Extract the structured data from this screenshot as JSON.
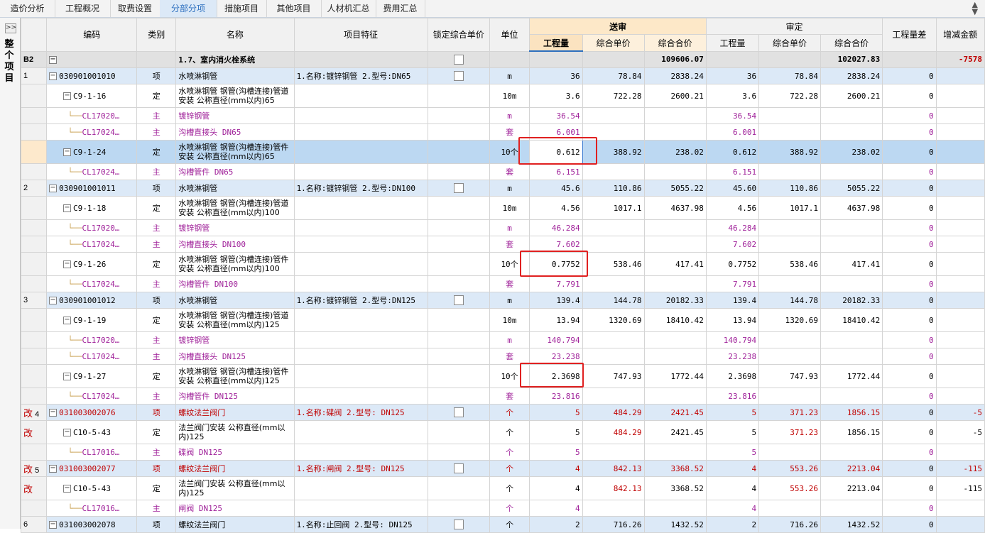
{
  "tabs": [
    "造价分析",
    "工程概况",
    "取费设置",
    "分部分项",
    "措施项目",
    "其他项目",
    "人材机汇总",
    "费用汇总"
  ],
  "active_tab": "分部分项",
  "side_title": "整个项目",
  "header": {
    "code": "编码",
    "type": "类别",
    "name": "名称",
    "feature": "项目特征",
    "lock": "锁定综合单价",
    "unit": "单位",
    "send": "送审",
    "approve": "审定",
    "qty": "工程量",
    "uprice": "综合单价",
    "total": "综合合价",
    "diff": "工程量差",
    "incdec": "增减金额"
  },
  "rows": [
    {
      "style": "sec",
      "no": "B2",
      "code": "",
      "type": "",
      "name": "1.7、室内消火栓系统",
      "feature": "",
      "lock": true,
      "unit": "",
      "sq": "",
      "sp": "",
      "st": "109606.07",
      "aq": "",
      "ap": "",
      "at": "102027.83",
      "diff": "",
      "inc": "-7578"
    },
    {
      "style": "qd",
      "no": "1",
      "code": "030901001010",
      "type": "项",
      "name": "水喷淋钢管",
      "feature": "1.名称:镀锌钢管 2.型号:DN65",
      "lock": true,
      "unit": "m",
      "sq": "36",
      "sp": "78.84",
      "st": "2838.24",
      "aq": "36",
      "ap": "78.84",
      "at": "2838.24",
      "diff": "0",
      "inc": ""
    },
    {
      "style": "de",
      "no": "",
      "code": "C9-1-16",
      "type": "定",
      "name": "水喷淋钢管 钢管(沟槽连接)管道安装 公称直径(mm以内)65",
      "feature": "",
      "lock": false,
      "unit": "10m",
      "sq": "3.6",
      "sp": "722.28",
      "st": "2600.21",
      "aq": "3.6",
      "ap": "722.28",
      "at": "2600.21",
      "diff": "0",
      "inc": ""
    },
    {
      "style": "zc",
      "no": "",
      "code": "CL17020…",
      "type": "主",
      "name": "镀锌钢管",
      "feature": "",
      "lock": false,
      "unit": "m",
      "sq": "36.54",
      "sp": "",
      "st": "",
      "aq": "36.54",
      "ap": "",
      "at": "",
      "diff": "0",
      "inc": ""
    },
    {
      "style": "zc",
      "no": "",
      "code": "CL17024…",
      "type": "主",
      "name": "沟槽直接头 DN65",
      "feature": "",
      "lock": false,
      "unit": "套",
      "sq": "6.001",
      "sp": "",
      "st": "",
      "aq": "6.001",
      "ap": "",
      "at": "",
      "diff": "0",
      "inc": ""
    },
    {
      "style": "sel",
      "no": "",
      "code": "C9-1-24",
      "type": "定",
      "name": "水喷淋钢管 钢管(沟槽连接)管件安装 公称直径(mm以内)65",
      "feature": "",
      "lock": false,
      "unit": "10个",
      "sq": "0.612",
      "sp": "388.92",
      "st": "238.02",
      "aq": "0.612",
      "ap": "388.92",
      "at": "238.02",
      "diff": "0",
      "inc": ""
    },
    {
      "style": "zc",
      "no": "",
      "code": "CL17024…",
      "type": "主",
      "name": "沟槽管件 DN65",
      "feature": "",
      "lock": false,
      "unit": "套",
      "sq": "6.151",
      "sp": "",
      "st": "",
      "aq": "6.151",
      "ap": "",
      "at": "",
      "diff": "0",
      "inc": ""
    },
    {
      "style": "qd",
      "no": "2",
      "code": "030901001011",
      "type": "项",
      "name": "水喷淋钢管",
      "feature": "1.名称:镀锌钢管 2.型号:DN100",
      "lock": true,
      "unit": "m",
      "sq": "45.6",
      "sp": "110.86",
      "st": "5055.22",
      "aq": "45.60",
      "ap": "110.86",
      "at": "5055.22",
      "diff": "0",
      "inc": ""
    },
    {
      "style": "de",
      "no": "",
      "code": "C9-1-18",
      "type": "定",
      "name": "水喷淋钢管 钢管(沟槽连接)管道安装 公称直径(mm以内)100",
      "feature": "",
      "lock": false,
      "unit": "10m",
      "sq": "4.56",
      "sp": "1017.1",
      "st": "4637.98",
      "aq": "4.56",
      "ap": "1017.1",
      "at": "4637.98",
      "diff": "0",
      "inc": ""
    },
    {
      "style": "zc",
      "no": "",
      "code": "CL17020…",
      "type": "主",
      "name": "镀锌钢管",
      "feature": "",
      "lock": false,
      "unit": "m",
      "sq": "46.284",
      "sp": "",
      "st": "",
      "aq": "46.284",
      "ap": "",
      "at": "",
      "diff": "0",
      "inc": ""
    },
    {
      "style": "zc",
      "no": "",
      "code": "CL17024…",
      "type": "主",
      "name": "沟槽直接头 DN100",
      "feature": "",
      "lock": false,
      "unit": "套",
      "sq": "7.602",
      "sp": "",
      "st": "",
      "aq": "7.602",
      "ap": "",
      "at": "",
      "diff": "0",
      "inc": ""
    },
    {
      "style": "de",
      "no": "",
      "code": "C9-1-26",
      "type": "定",
      "name": "水喷淋钢管 钢管(沟槽连接)管件安装 公称直径(mm以内)100",
      "feature": "",
      "lock": false,
      "unit": "10个",
      "sq": "0.7752",
      "sp": "538.46",
      "st": "417.41",
      "aq": "0.7752",
      "ap": "538.46",
      "at": "417.41",
      "diff": "0",
      "inc": ""
    },
    {
      "style": "zc",
      "no": "",
      "code": "CL17024…",
      "type": "主",
      "name": "沟槽管件 DN100",
      "feature": "",
      "lock": false,
      "unit": "套",
      "sq": "7.791",
      "sp": "",
      "st": "",
      "aq": "7.791",
      "ap": "",
      "at": "",
      "diff": "0",
      "inc": ""
    },
    {
      "style": "qd",
      "no": "3",
      "code": "030901001012",
      "type": "项",
      "name": "水喷淋钢管",
      "feature": "1.名称:镀锌钢管 2.型号:DN125",
      "lock": true,
      "unit": "m",
      "sq": "139.4",
      "sp": "144.78",
      "st": "20182.33",
      "aq": "139.4",
      "ap": "144.78",
      "at": "20182.33",
      "diff": "0",
      "inc": ""
    },
    {
      "style": "de",
      "no": "",
      "code": "C9-1-19",
      "type": "定",
      "name": "水喷淋钢管 钢管(沟槽连接)管道安装 公称直径(mm以内)125",
      "feature": "",
      "lock": false,
      "unit": "10m",
      "sq": "13.94",
      "sp": "1320.69",
      "st": "18410.42",
      "aq": "13.94",
      "ap": "1320.69",
      "at": "18410.42",
      "diff": "0",
      "inc": ""
    },
    {
      "style": "zc",
      "no": "",
      "code": "CL17020…",
      "type": "主",
      "name": "镀锌钢管",
      "feature": "",
      "lock": false,
      "unit": "m",
      "sq": "140.794",
      "sp": "",
      "st": "",
      "aq": "140.794",
      "ap": "",
      "at": "",
      "diff": "0",
      "inc": ""
    },
    {
      "style": "zc",
      "no": "",
      "code": "CL17024…",
      "type": "主",
      "name": "沟槽直接头 DN125",
      "feature": "",
      "lock": false,
      "unit": "套",
      "sq": "23.238",
      "sp": "",
      "st": "",
      "aq": "23.238",
      "ap": "",
      "at": "",
      "diff": "0",
      "inc": ""
    },
    {
      "style": "de",
      "no": "",
      "code": "C9-1-27",
      "type": "定",
      "name": "水喷淋钢管 钢管(沟槽连接)管件安装 公称直径(mm以内)125",
      "feature": "",
      "lock": false,
      "unit": "10个",
      "sq": "2.3698",
      "sp": "747.93",
      "st": "1772.44",
      "aq": "2.3698",
      "ap": "747.93",
      "at": "1772.44",
      "diff": "0",
      "inc": ""
    },
    {
      "style": "zc",
      "no": "",
      "code": "CL17024…",
      "type": "主",
      "name": "沟槽管件 DN125",
      "feature": "",
      "lock": false,
      "unit": "套",
      "sq": "23.816",
      "sp": "",
      "st": "",
      "aq": "23.816",
      "ap": "",
      "at": "",
      "diff": "0",
      "inc": ""
    },
    {
      "style": "qdmod",
      "no": "4",
      "mod": "改",
      "code": "031003002076",
      "type": "项",
      "name": "螺纹法兰阀门",
      "feature": "1.名称:碟阀 2.型号: DN125",
      "lock": true,
      "unit": "个",
      "sq": "5",
      "sp": "484.29",
      "st": "2421.45",
      "aq": "5",
      "ap": "371.23",
      "at": "1856.15",
      "diff": "0",
      "inc": "-5"
    },
    {
      "style": "demod",
      "no": "",
      "mod": "改",
      "code": "C10-5-43",
      "type": "定",
      "name": "法兰阀门安装 公称直径(mm以内)125",
      "feature": "",
      "lock": false,
      "unit": "个",
      "sq": "5",
      "sp": "484.29",
      "st": "2421.45",
      "aq": "5",
      "ap": "371.23",
      "at": "1856.15",
      "diff": "0",
      "inc": "-5"
    },
    {
      "style": "zc",
      "no": "",
      "code": "CL17016…",
      "type": "主",
      "name": "碟阀 DN125",
      "feature": "",
      "lock": false,
      "unit": "个",
      "sq": "5",
      "sp": "",
      "st": "",
      "aq": "5",
      "ap": "",
      "at": "",
      "diff": "0",
      "inc": ""
    },
    {
      "style": "qdmod",
      "no": "5",
      "mod": "改",
      "code": "031003002077",
      "type": "项",
      "name": "螺纹法兰阀门",
      "feature": "1.名称:闸阀 2.型号: DN125",
      "lock": true,
      "unit": "个",
      "sq": "4",
      "sp": "842.13",
      "st": "3368.52",
      "aq": "4",
      "ap": "553.26",
      "at": "2213.04",
      "diff": "0",
      "inc": "-115"
    },
    {
      "style": "demod",
      "no": "",
      "mod": "改",
      "code": "C10-5-43",
      "type": "定",
      "name": "法兰阀门安装 公称直径(mm以内)125",
      "feature": "",
      "lock": false,
      "unit": "个",
      "sq": "4",
      "sp": "842.13",
      "st": "3368.52",
      "aq": "4",
      "ap": "553.26",
      "at": "2213.04",
      "diff": "0",
      "inc": "-115"
    },
    {
      "style": "zc",
      "no": "",
      "code": "CL17016…",
      "type": "主",
      "name": "闸阀 DN125",
      "feature": "",
      "lock": false,
      "unit": "个",
      "sq": "4",
      "sp": "",
      "st": "",
      "aq": "4",
      "ap": "",
      "at": "",
      "diff": "0",
      "inc": ""
    },
    {
      "style": "qd",
      "no": "6",
      "code": "031003002078",
      "type": "项",
      "name": "螺纹法兰阀门",
      "feature": "1.名称:止回阀 2.型号: DN125",
      "lock": true,
      "unit": "个",
      "sq": "2",
      "sp": "716.26",
      "st": "1432.52",
      "aq": "2",
      "ap": "716.26",
      "at": "1432.52",
      "diff": "0",
      "inc": ""
    }
  ]
}
